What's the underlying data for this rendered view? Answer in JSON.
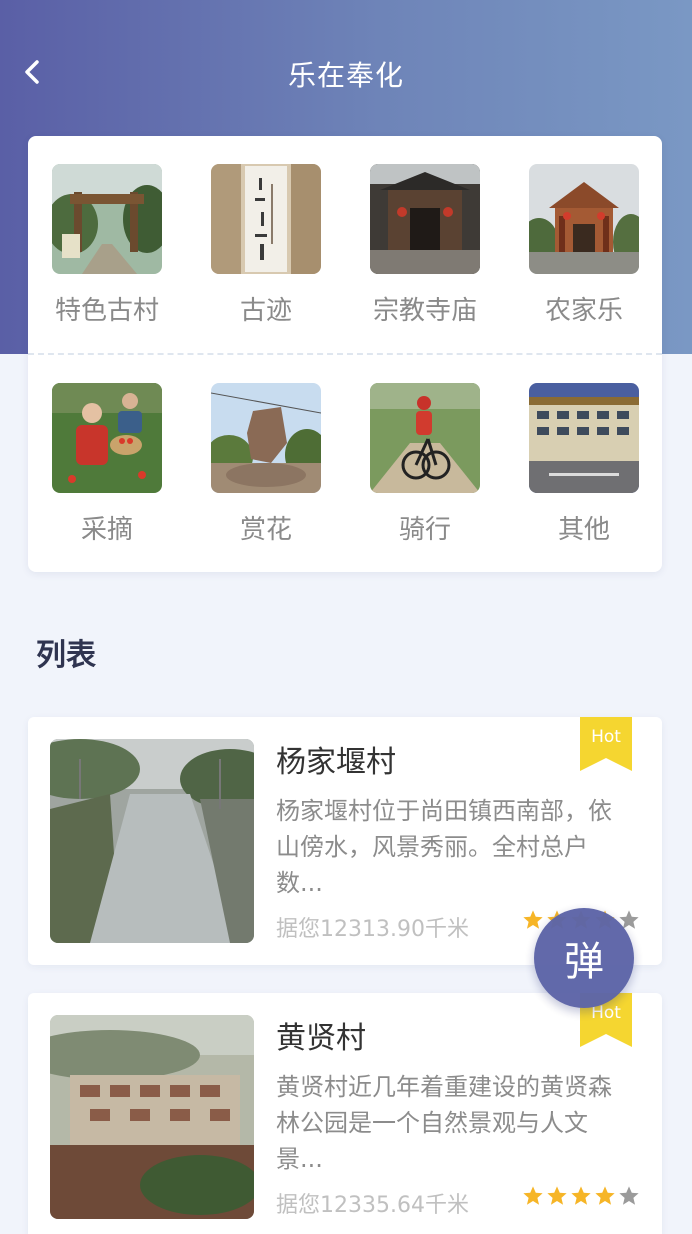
{
  "header": {
    "title": "乐在奉化",
    "back_icon": "chevron-left-icon"
  },
  "categories": [
    {
      "label": "特色古村",
      "icon": "village-gate-photo"
    },
    {
      "label": "古迹",
      "icon": "calligraphy-photo"
    },
    {
      "label": "宗教寺庙",
      "icon": "temple-photo"
    },
    {
      "label": "农家乐",
      "icon": "farmhouse-photo"
    },
    {
      "label": "采摘",
      "icon": "picking-photo"
    },
    {
      "label": "赏花",
      "icon": "flower-rock-photo"
    },
    {
      "label": "骑行",
      "icon": "cycling-photo"
    },
    {
      "label": "其他",
      "icon": "building-photo"
    }
  ],
  "list": {
    "section_title": "列表",
    "items": [
      {
        "name": "杨家堰村",
        "description": "杨家堰村位于尚田镇西南部，依山傍水，风景秀丽。全村总户数...",
        "distance": "据您12313.90千米",
        "badge": "Hot",
        "rating": 4,
        "rating_max": 5
      },
      {
        "name": "黄贤村",
        "description": "黄贤村近几年着重建设的黄贤森林公园是一个自然景观与人文景...",
        "distance": "据您12335.64千米",
        "badge": "Hot",
        "rating": 4,
        "rating_max": 5
      }
    ]
  },
  "float_button": {
    "label": "弹"
  },
  "colors": {
    "header_gradient_start": "#5a5fa6",
    "header_gradient_end": "#7a98c4",
    "badge": "#f5d630",
    "star_on": "#f6b527",
    "star_off": "#9b9b9b",
    "float_button": "#5d65a8"
  }
}
